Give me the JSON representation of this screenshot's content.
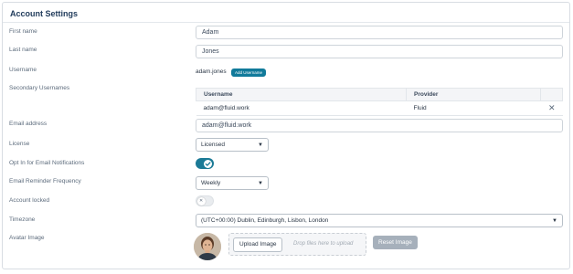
{
  "title": "Account Settings",
  "fields": {
    "first_name": {
      "label": "First name",
      "value": "Adam"
    },
    "last_name": {
      "label": "Last name",
      "value": "Jones"
    },
    "username": {
      "label": "Username",
      "value": "adam.jones",
      "add_label": "Add Username"
    },
    "secondary": {
      "label": "Secondary Usernames",
      "headers": [
        "Username",
        "Provider",
        ""
      ],
      "rows": [
        {
          "username": "adam@fluid.work",
          "provider": "Fluid",
          "remove_icon": "close-icon",
          "remove": "✕"
        }
      ]
    },
    "email": {
      "label": "Email address",
      "value": "adam@fluid.work"
    },
    "license": {
      "label": "License",
      "selected": "Licensed"
    },
    "opt_in": {
      "label": "Opt In for Email Notifications",
      "state": "on"
    },
    "reminder": {
      "label": "Email Reminder Frequency",
      "selected": "Weekly"
    },
    "locked": {
      "label": "Account locked",
      "state": "off"
    },
    "timezone": {
      "label": "Timezone",
      "selected": "(UTC+00:00) Dublin, Edinburgh, Lisbon, London"
    },
    "avatar": {
      "label": "Avatar Image",
      "upload_label": "Upload Image",
      "drop_text": "Drop files here to upload",
      "reset_label": "Reset Image"
    }
  },
  "colors": {
    "accent": "#1b7a96",
    "badge": "#117a9a",
    "title": "#1f3a5a",
    "disabled": "#a6b0bb"
  },
  "icons": {
    "caret": "▼",
    "caret_name": "chevron-down-icon",
    "check": "check-icon",
    "close": "✕"
  }
}
